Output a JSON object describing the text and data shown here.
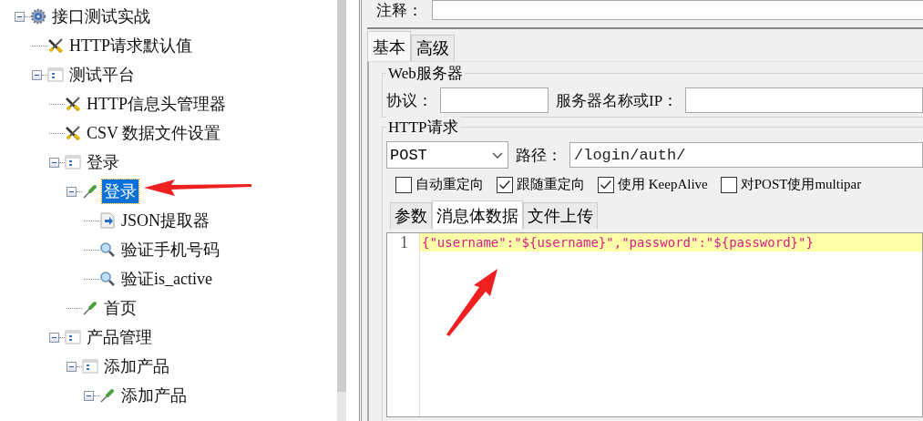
{
  "tree": [
    {
      "label": "接口测试实战",
      "kind": "gear",
      "expanded": true,
      "selected": false,
      "children": [
        {
          "label": "HTTP请求默认值",
          "kind": "wrench",
          "selected": false
        },
        {
          "label": "测试平台",
          "kind": "controller",
          "expanded": true,
          "selected": false,
          "children": [
            {
              "label": "HTTP信息头管理器",
              "kind": "wrench",
              "selected": false
            },
            {
              "label": "CSV 数据文件设置",
              "kind": "wrench",
              "selected": false
            },
            {
              "label": "登录",
              "kind": "controller",
              "expanded": true,
              "selected": false,
              "children": [
                {
                  "label": "登录",
                  "kind": "sampler",
                  "expanded": true,
                  "selected": true,
                  "children": [
                    {
                      "label": "JSON提取器",
                      "kind": "extractor",
                      "selected": false
                    },
                    {
                      "label": "验证手机号码",
                      "kind": "assertion",
                      "selected": false
                    },
                    {
                      "label": "验证is_active",
                      "kind": "assertion",
                      "selected": false
                    }
                  ]
                },
                {
                  "label": "首页",
                  "kind": "sampler",
                  "selected": false
                }
              ]
            },
            {
              "label": "产品管理",
              "kind": "controller",
              "expanded": true,
              "selected": false,
              "children": [
                {
                  "label": "添加产品",
                  "kind": "controller",
                  "expanded": true,
                  "selected": false,
                  "children": [
                    {
                      "label": "添加产品",
                      "kind": "sampler",
                      "expanded": true,
                      "selected": false
                    }
                  ]
                }
              ]
            }
          ]
        }
      ]
    }
  ],
  "comment": {
    "label": "注释："
  },
  "tabs": [
    {
      "label": "基本",
      "selected": true
    },
    {
      "label": "高级",
      "selected": false
    }
  ],
  "web_server": {
    "title": "Web服务器",
    "protocol_label": "协议：",
    "server_label": "服务器名称或IP："
  },
  "http_request": {
    "title": "HTTP请求",
    "method": "POST",
    "path_label": "路径：",
    "path": "/login/auth/"
  },
  "options": [
    {
      "label": "自动重定向",
      "checked": false
    },
    {
      "label": "跟随重定向",
      "checked": true
    },
    {
      "label": "使用 KeepAlive",
      "checked": true
    },
    {
      "label": "对POST使用multipar",
      "checked": false
    }
  ],
  "body_tabs": [
    {
      "label": "参数",
      "selected": false
    },
    {
      "label": "消息体数据",
      "selected": true
    },
    {
      "label": "文件上传",
      "selected": false
    }
  ],
  "editor": {
    "lines": [
      {
        "number": "1",
        "text": "{\"username\":\"${username}\",\"password\":\"${password}\"}",
        "current": true
      }
    ]
  }
}
